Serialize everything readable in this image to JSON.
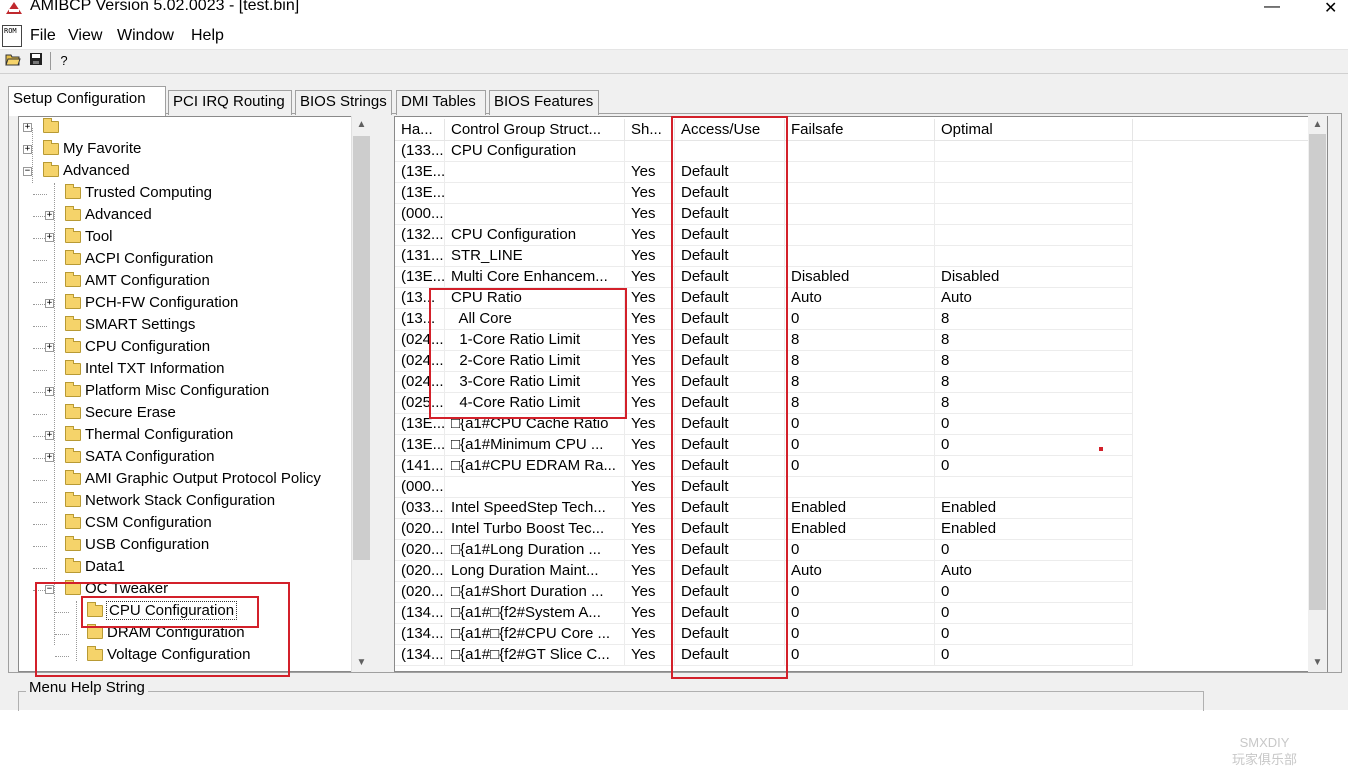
{
  "window": {
    "title": "AMIBCP Version 5.02.0023 - [test.bin]",
    "minimize_glyph": "—",
    "close_glyph": "✕"
  },
  "menu": [
    "File",
    "View",
    "Window",
    "Help"
  ],
  "doc_icon_text": "ROM",
  "toolbar": {
    "icons": [
      "open-folder-icon",
      "save-disk-icon",
      "help-pointer-icon"
    ],
    "help_glyph": "?"
  },
  "tabs": [
    {
      "label": "Setup Configuration",
      "active": true
    },
    {
      "label": "PCI IRQ Routing",
      "active": false
    },
    {
      "label": "BIOS Strings",
      "active": false
    },
    {
      "label": "DMI Tables",
      "active": false
    },
    {
      "label": "BIOS Features",
      "active": false
    }
  ],
  "tree": [
    {
      "label": "",
      "level": 0,
      "exp": "+"
    },
    {
      "label": "My Favorite",
      "level": 0,
      "exp": "+"
    },
    {
      "label": "Advanced",
      "level": 0,
      "exp": "-"
    },
    {
      "label": "Trusted Computing",
      "level": 1,
      "exp": ""
    },
    {
      "label": "Advanced",
      "level": 1,
      "exp": "+"
    },
    {
      "label": "Tool",
      "level": 1,
      "exp": "+"
    },
    {
      "label": "ACPI Configuration",
      "level": 1,
      "exp": ""
    },
    {
      "label": "AMT Configuration",
      "level": 1,
      "exp": ""
    },
    {
      "label": "PCH-FW Configuration",
      "level": 1,
      "exp": "+"
    },
    {
      "label": "SMART Settings",
      "level": 1,
      "exp": ""
    },
    {
      "label": "CPU Configuration",
      "level": 1,
      "exp": "+"
    },
    {
      "label": "Intel TXT Information",
      "level": 1,
      "exp": ""
    },
    {
      "label": "Platform Misc Configuration",
      "level": 1,
      "exp": "+"
    },
    {
      "label": "Secure Erase",
      "level": 1,
      "exp": ""
    },
    {
      "label": "Thermal Configuration",
      "level": 1,
      "exp": "+"
    },
    {
      "label": "SATA Configuration",
      "level": 1,
      "exp": "+"
    },
    {
      "label": "AMI Graphic Output Protocol Policy",
      "level": 1,
      "exp": ""
    },
    {
      "label": "Network Stack Configuration",
      "level": 1,
      "exp": ""
    },
    {
      "label": "CSM Configuration",
      "level": 1,
      "exp": ""
    },
    {
      "label": "USB Configuration",
      "level": 1,
      "exp": ""
    },
    {
      "label": "Data1",
      "level": 1,
      "exp": ""
    },
    {
      "label": "OC Tweaker",
      "level": 1,
      "exp": "-"
    },
    {
      "label": "CPU Configuration",
      "level": 2,
      "exp": "",
      "selected": true
    },
    {
      "label": "DRAM Configuration",
      "level": 2,
      "exp": ""
    },
    {
      "label": "Voltage Configuration",
      "level": 2,
      "exp": ""
    }
  ],
  "grid": {
    "columns": [
      "Ha...",
      "Control Group Struct...",
      "Sh...",
      "Access/Use",
      "Failsafe",
      "Optimal"
    ],
    "rows": [
      [
        "(133...",
        "CPU Configuration",
        "",
        "",
        "",
        ""
      ],
      [
        "(13E...",
        "",
        "Yes",
        "Default",
        "",
        ""
      ],
      [
        "(13E...",
        "",
        "Yes",
        "Default",
        "",
        ""
      ],
      [
        "(000...",
        "",
        "Yes",
        "Default",
        "",
        ""
      ],
      [
        "(132...",
        "CPU Configuration",
        "Yes",
        "Default",
        "",
        ""
      ],
      [
        "(131...",
        "STR_LINE",
        "Yes",
        "Default",
        "",
        ""
      ],
      [
        "(13E...",
        "Multi Core Enhancem...",
        "Yes",
        "Default",
        "Disabled",
        "Disabled"
      ],
      [
        "(13...",
        "CPU Ratio",
        "Yes",
        "Default",
        "Auto",
        "Auto"
      ],
      [
        "(13...",
        "  All Core",
        "Yes",
        "Default",
        "0",
        "8"
      ],
      [
        "(024...",
        "  1-Core Ratio Limit",
        "Yes",
        "Default",
        "8",
        "8"
      ],
      [
        "(024...",
        "  2-Core Ratio Limit",
        "Yes",
        "Default",
        "8",
        "8"
      ],
      [
        "(024...",
        "  3-Core Ratio Limit",
        "Yes",
        "Default",
        "8",
        "8"
      ],
      [
        "(025...",
        "  4-Core Ratio Limit",
        "Yes",
        "Default",
        "8",
        "8"
      ],
      [
        "(13E...",
        "□{a1#CPU Cache Ratio",
        "Yes",
        "Default",
        "0",
        "0"
      ],
      [
        "(13E...",
        "□{a1#Minimum CPU ...",
        "Yes",
        "Default",
        "0",
        "0"
      ],
      [
        "(141...",
        "□{a1#CPU EDRAM Ra...",
        "Yes",
        "Default",
        "0",
        "0"
      ],
      [
        "(000...",
        "",
        "Yes",
        "Default",
        "",
        ""
      ],
      [
        "(033...",
        "Intel SpeedStep Tech...",
        "Yes",
        "Default",
        "Enabled",
        "Enabled"
      ],
      [
        "(020...",
        "Intel Turbo Boost Tec...",
        "Yes",
        "Default",
        "Enabled",
        "Enabled"
      ],
      [
        "(020...",
        "□{a1#Long Duration ...",
        "Yes",
        "Default",
        "0",
        "0"
      ],
      [
        "(020...",
        "Long Duration Maint...",
        "Yes",
        "Default",
        "Auto",
        "Auto"
      ],
      [
        "(020...",
        "□{a1#Short Duration ...",
        "Yes",
        "Default",
        "0",
        "0"
      ],
      [
        "(134...",
        "□{a1#□{f2#System A...",
        "Yes",
        "Default",
        "0",
        "0"
      ],
      [
        "(134...",
        "□{a1#□{f2#CPU Core ...",
        "Yes",
        "Default",
        "0",
        "0"
      ],
      [
        "(134...",
        "□{a1#□{f2#GT Slice C...",
        "Yes",
        "Default",
        "0",
        "0"
      ]
    ]
  },
  "help": {
    "label": "Menu Help String"
  },
  "watermark": {
    "line1": "SMXDIY",
    "line2": "玩家俱乐部"
  },
  "colors": {
    "annotation": "#d3202a",
    "folder": "#f5d36a"
  }
}
